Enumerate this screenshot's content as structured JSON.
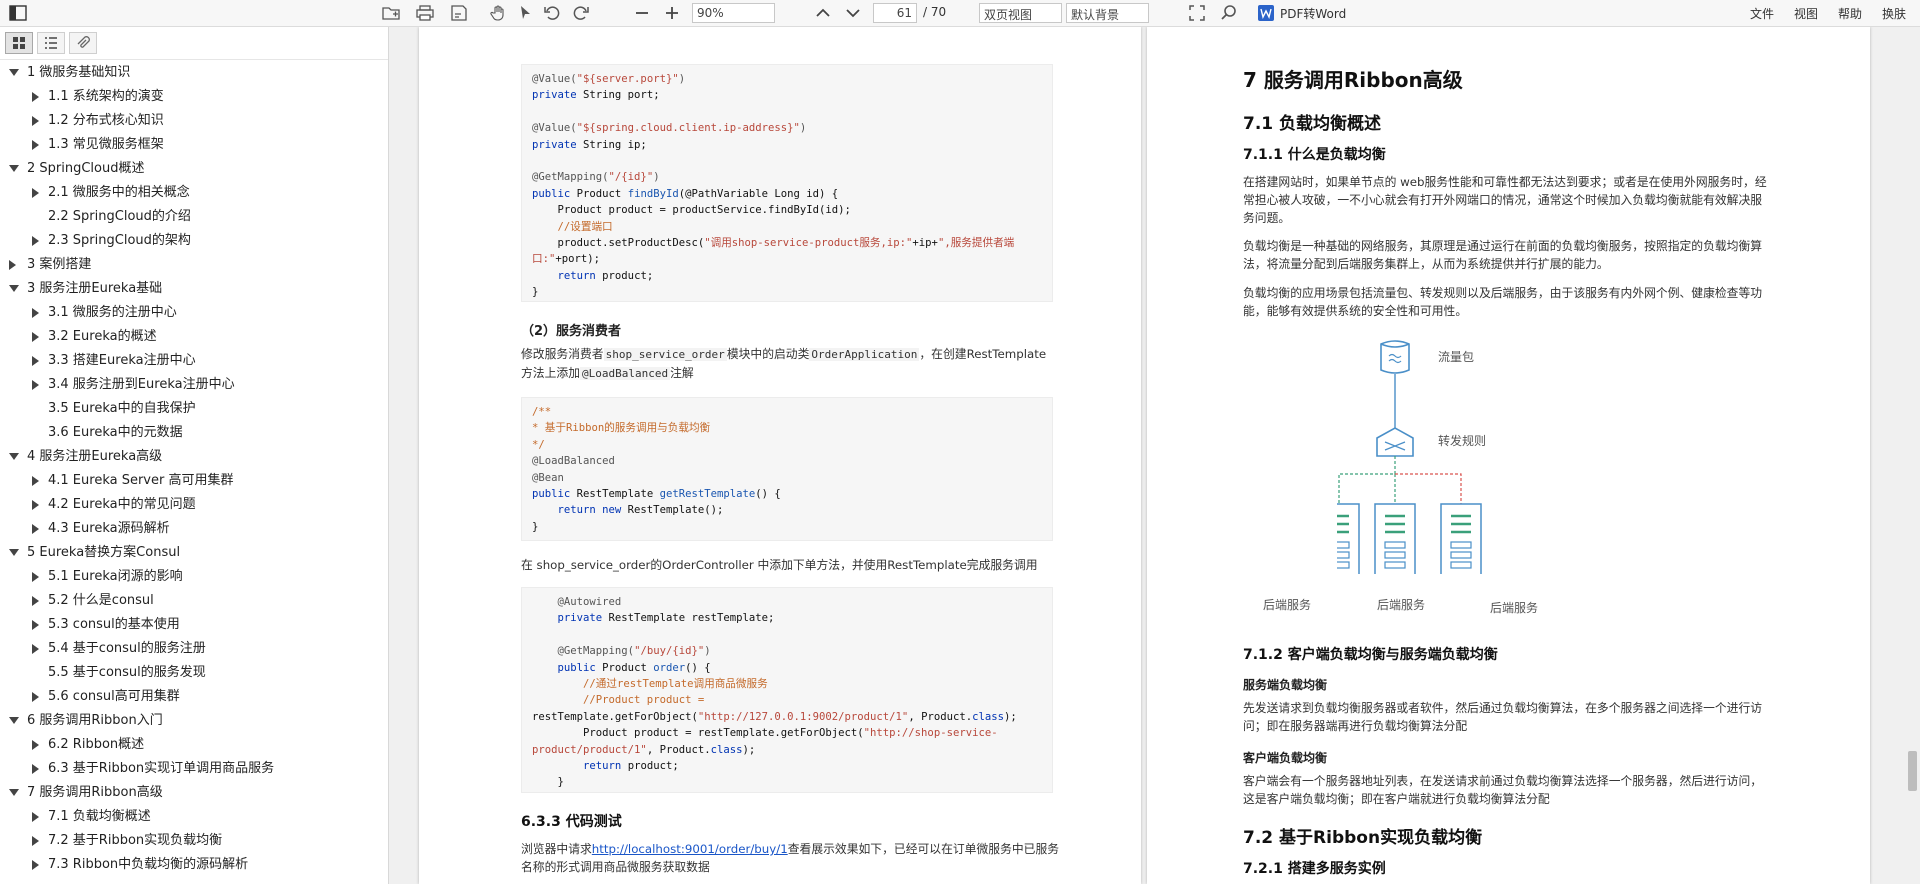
{
  "toolbar": {
    "zoom": "90%",
    "page_current": "61",
    "page_total": "/ 70",
    "view_mode": "双页视图",
    "background": "默认背景",
    "pdf_to_word": "PDF转Word",
    "menu_file": "文件",
    "menu_view": "视图",
    "menu_help": "帮助",
    "menu_skin": "换肤"
  },
  "outline": [
    {
      "label": "1 微服务基础知识",
      "level": 0,
      "state": "expanded"
    },
    {
      "label": "1.1 系统架构的演变",
      "level": 1,
      "state": "collapsed"
    },
    {
      "label": "1.2 分布式核心知识",
      "level": 1,
      "state": "collapsed"
    },
    {
      "label": "1.3 常见微服务框架",
      "level": 1,
      "state": "collapsed"
    },
    {
      "label": "2 SpringCloud概述",
      "level": 0,
      "state": "expanded"
    },
    {
      "label": "2.1 微服务中的相关概念",
      "level": 1,
      "state": "collapsed"
    },
    {
      "label": "2.2 SpringCloud的介绍",
      "level": 1,
      "state": "leaf"
    },
    {
      "label": "2.3 SpringCloud的架构",
      "level": 1,
      "state": "collapsed"
    },
    {
      "label": "3 案例搭建",
      "level": 0,
      "state": "collapsed"
    },
    {
      "label": "3 服务注册Eureka基础",
      "level": 0,
      "state": "expanded"
    },
    {
      "label": "3.1 微服务的注册中心",
      "level": 1,
      "state": "collapsed"
    },
    {
      "label": "3.2 Eureka的概述",
      "level": 1,
      "state": "collapsed"
    },
    {
      "label": "3.3 搭建Eureka注册中心",
      "level": 1,
      "state": "collapsed"
    },
    {
      "label": "3.4 服务注册到Eureka注册中心",
      "level": 1,
      "state": "collapsed"
    },
    {
      "label": "3.5 Eureka中的自我保护",
      "level": 1,
      "state": "leaf"
    },
    {
      "label": "3.6 Eureka中的元数据",
      "level": 1,
      "state": "leaf"
    },
    {
      "label": "4 服务注册Eureka高级",
      "level": 0,
      "state": "expanded"
    },
    {
      "label": "4.1 Eureka Server 高可用集群",
      "level": 1,
      "state": "collapsed"
    },
    {
      "label": "4.2 Eureka中的常见问题",
      "level": 1,
      "state": "collapsed"
    },
    {
      "label": "4.3 Eureka源码解析",
      "level": 1,
      "state": "collapsed"
    },
    {
      "label": "5 Eureka替换方案Consul",
      "level": 0,
      "state": "expanded"
    },
    {
      "label": "5.1 Eureka闭源的影响",
      "level": 1,
      "state": "collapsed"
    },
    {
      "label": "5.2 什么是consul",
      "level": 1,
      "state": "collapsed"
    },
    {
      "label": "5.3 consul的基本使用",
      "level": 1,
      "state": "collapsed"
    },
    {
      "label": "5.4 基于consul的服务注册",
      "level": 1,
      "state": "collapsed"
    },
    {
      "label": "5.5 基于consul的服务发现",
      "level": 1,
      "state": "leaf"
    },
    {
      "label": "5.6 consul高可用集群",
      "level": 1,
      "state": "collapsed"
    },
    {
      "label": "6 服务调用Ribbon入门",
      "level": 0,
      "state": "expanded"
    },
    {
      "label": "6.2 Ribbon概述",
      "level": 1,
      "state": "collapsed"
    },
    {
      "label": "6.3 基于Ribbon实现订单调用商品服务",
      "level": 1,
      "state": "collapsed"
    },
    {
      "label": "7 服务调用Ribbon高级",
      "level": 0,
      "state": "expanded"
    },
    {
      "label": "7.1 负载均衡概述",
      "level": 1,
      "state": "collapsed"
    },
    {
      "label": "7.2 基于Ribbon实现负载均衡",
      "level": 1,
      "state": "collapsed"
    },
    {
      "label": "7.3 Ribbon中负载均衡的源码解析",
      "level": 1,
      "state": "collapsed"
    }
  ],
  "left_page": {
    "heading_consumer": "（2）服务消费者",
    "para1_a": "修改服务消费者",
    "para1_code1": "shop_service_order",
    "para1_b": "模块中的启动类",
    "para1_code2": "OrderApplication",
    "para1_c": "，在创建RestTemplate方法上添加",
    "para1_code3": "@LoadBalanced",
    "para1_d": "注解",
    "para2": "在 shop_service_order的OrderController 中添加下单方法，并使用RestTemplate完成服务调用",
    "heading_test": "6.3.3 代码测试",
    "test_a": "浏览器中请求",
    "test_link": "http://localhost:9001/order/buy/1",
    "test_b": "查看展示效果如下，已经可以在订单微服务中已服务名称的形式调用商品微服务获取数据"
  },
  "right_page": {
    "h1": "7 服务调用Ribbon高级",
    "h2_1": "7.1 负载均衡概述",
    "h3_1": "7.1.1 什么是负载均衡",
    "p1": "在搭建网站时，如果单节点的 web服务性能和可靠性都无法达到要求；或者是在使用外网服务时，经常担心被人攻破，一不小心就会有打开外网端口的情况，通常这个时候加入负载均衡就能有效解决服务问题。",
    "p2": "负载均衡是一种基础的网络服务，其原理是通过运行在前面的负载均衡服务，按照指定的负载均衡算法，将流量分配到后端服务集群上，从而为系统提供并行扩展的能力。",
    "p3": "负载均衡的应用场景包括流量包、转发规则以及后端服务，由于该服务有内外网个例、健康检查等功能，能够有效提供系统的安全性和可用性。",
    "diag_traffic": "流量包",
    "diag_rule": "转发规则",
    "diag_backend1": "后端服务",
    "diag_backend2": "后端服务",
    "diag_backend3": "后端服务",
    "h3_2": "7.1.2 客户端负载均衡与服务端负载均衡",
    "h4_1": "服务端负载均衡",
    "p4": "先发送请求到负载均衡服务器或者软件，然后通过负载均衡算法，在多个服务器之间选择一个进行访问；即在服务器端再进行负载均衡算法分配",
    "h4_2": "客户端负载均衡",
    "p5": "客户端会有一个服务器地址列表，在发送请求前通过负载均衡算法选择一个服务器，然后进行访问，这是客户端负载均衡；即在客户端就进行负载均衡算法分配",
    "h2_2": "7.2 基于Ribbon实现负载均衡",
    "h3_3": "7.2.1 搭建多服务实例"
  },
  "colors": {
    "accent": "#1a56c8",
    "diagram": "#4a8fc8",
    "green_link": "#3aa07a",
    "red_link": "#d9534f"
  }
}
